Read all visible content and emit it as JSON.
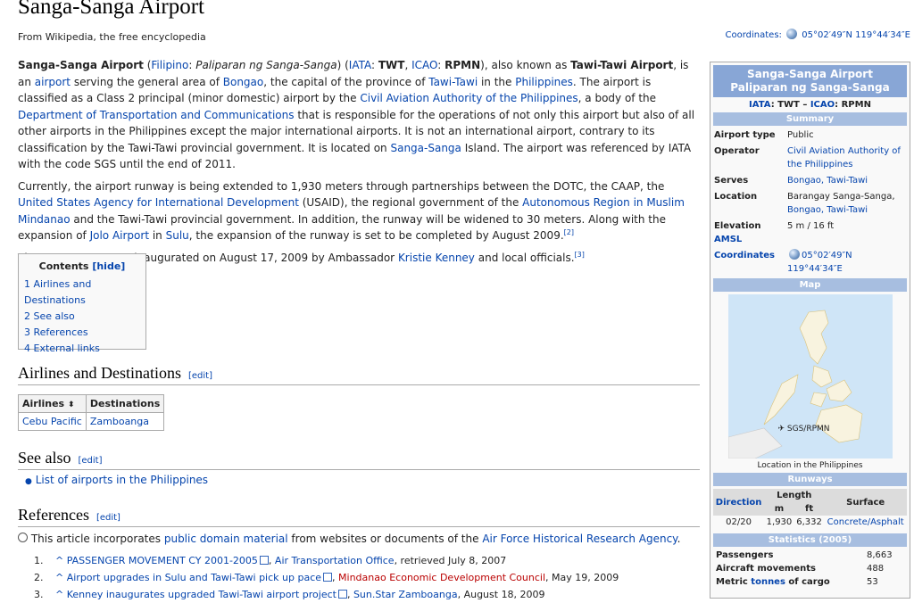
{
  "page": {
    "title": "Sanga-Sanga Airport",
    "tagline": "From Wikipedia, the free encyclopedia",
    "coords_label": "Coordinates:",
    "coords_value": "05°02′49″N 119°44′34″E"
  },
  "article": {
    "p1": {
      "name_bold": "Sanga-Sanga Airport",
      "open_paren": " (",
      "filipino": "Filipino",
      "colon": ": ",
      "filipino_name": "Paliparan ng Sanga-Sanga",
      "close_open": ") (",
      "iata": "IATA",
      "iata_code": "TWT",
      "comma1": ", ",
      "icao": "ICAO",
      "icao_code": "RPMN",
      "aka": "), also known as ",
      "aka_bold": "Tawi-Tawi Airport",
      "is_an": ", is an ",
      "airport": "airport",
      "serving": " serving the general area of ",
      "bongao": "Bongao",
      "capital": ", the capital of the province of ",
      "tawitawi": "Tawi-Tawi",
      "in_the": " in the ",
      "philippines": "Philippines",
      "classified": ". The airport is classified as a Class 2 principal (minor domestic) airport by the ",
      "caap": "Civil Aviation Authority of the Philippines",
      "body": ", a body of the ",
      "dotc": "Department of Transportation and Communications",
      "rest1": " that is responsible for the operations of not only this airport but also of all other airports in the Philippines except the major international airports. It is not an international airport, contrary to its classification by the Tawi-Tawi provincial government. It is located on ",
      "island": "Sanga-Sanga",
      "rest2": " Island. The airport was referenced by IATA with the code SGS until the end of 2011."
    },
    "p2": {
      "a": "Currently, the airport runway is being extended to 1,930 meters through partnerships between the DOTC, the CAAP, the ",
      "usaid": "United States Agency for International Development",
      "b": " (USAID), the regional government of the ",
      "armm": "Autonomous Region in Muslim Mindanao",
      "c": " and the Tawi-Tawi provincial government. In addition, the runway will be widened to 30 meters. Along with the expansion of ",
      "jolo": "Jolo Airport",
      "d": " in ",
      "sulu": "Sulu",
      "e": ", the expansion of the runway is set to be completed by August 2009.",
      "ref": "[2]"
    },
    "p3": {
      "a": "The new runway was inaugurated on August 17, 2009 by Ambassador ",
      "kenney": "Kristie Kenney",
      "b": " and local officials.",
      "ref": "[3]"
    }
  },
  "toc": {
    "title": "Contents",
    "hide": "[hide]",
    "items": [
      "1 Airlines and Destinations",
      "2 See also",
      "3 References",
      "4 External links"
    ]
  },
  "sections": {
    "airlines": "Airlines and Destinations",
    "seealso": "See also",
    "references": "References",
    "edit": "[edit]"
  },
  "airlines_table": {
    "headers": [
      "Airlines",
      "Destinations"
    ],
    "sort_glyph": "⬍",
    "rows": [
      [
        "Cebu Pacific",
        "Zamboanga"
      ]
    ]
  },
  "seealso": {
    "items": [
      "List of airports in the Philippines"
    ]
  },
  "references": {
    "note_a": "This article incorporates ",
    "note_link": "public domain material",
    "note_b": " from websites or documents of the ",
    "note_afhra": "Air Force Historical Research Agency",
    "note_c": ".",
    "items": [
      {
        "num": "1.",
        "caret": "^",
        "title": "PASSENGER MOVEMENT CY 2001-2005",
        "sep": ", ",
        "publisher": "Air Transportation Office",
        "tail": ", retrieved July 8, 2007"
      },
      {
        "num": "2.",
        "caret": "^",
        "title": "Airport upgrades in Sulu and Tawi-Tawi pick up pace",
        "sep": ", ",
        "publisher": "Mindanao Economic Development Council",
        "tail": ", May 19, 2009"
      },
      {
        "num": "3.",
        "caret": "^",
        "title": "Kenney inaugurates upgraded Tawi-Tawi airport project",
        "sep": ", ",
        "publisher": "Sun.Star Zamboanga",
        "tail": ", August 18, 2009"
      }
    ]
  },
  "infobox": {
    "title1": "Sanga-Sanga Airport",
    "title2": "Paliparan ng Sanga-Sanga",
    "iata": "IATA",
    "iata_code": ": TWT – ",
    "icao": "ICAO",
    "icao_code": ": RPMN",
    "summary": "Summary",
    "rows": {
      "type_k": "Airport type",
      "type_v": "Public",
      "operator_k": "Operator",
      "operator_v": "Civil Aviation Authority of the Philippines",
      "serves_k": "Serves",
      "serves_v": "Bongao, Tawi-Tawi",
      "location_k": "Location",
      "location_v1": "Barangay Sanga-Sanga,",
      "location_v2": "Bongao, Tawi-Tawi",
      "elev_k": "Elevation ",
      "elev_amsl": "AMSL",
      "elev_v": "5 m / 16 ft",
      "coords_k": "Coordinates",
      "coords_v": "05°02′49″N 119°44′34″E"
    },
    "map": "Map",
    "map_marker": "SGS/RPMN",
    "map_caption": "Location in the Philippines",
    "runways": "Runways",
    "rw_headers": {
      "direction": "Direction",
      "length": "Length",
      "surface": "Surface",
      "m": "m",
      "ft": "ft"
    },
    "rw_rows": [
      [
        "02/20",
        "1,930",
        "6,332",
        "Concrete/Asphalt"
      ]
    ],
    "statistics": "Statistics (2005)",
    "stats": [
      {
        "k": "Passengers",
        "v": "8,663"
      },
      {
        "k": "Aircraft movements",
        "v": "488"
      },
      {
        "k_a": "Metric ",
        "k_link": "tonnes",
        "k_b": " of cargo",
        "v": "53"
      }
    ]
  },
  "colors": {
    "link": "#0645ad",
    "redlink": "#ba0000",
    "infobox_title": "#88a6d6",
    "infobox_section": "#a7bee0"
  }
}
